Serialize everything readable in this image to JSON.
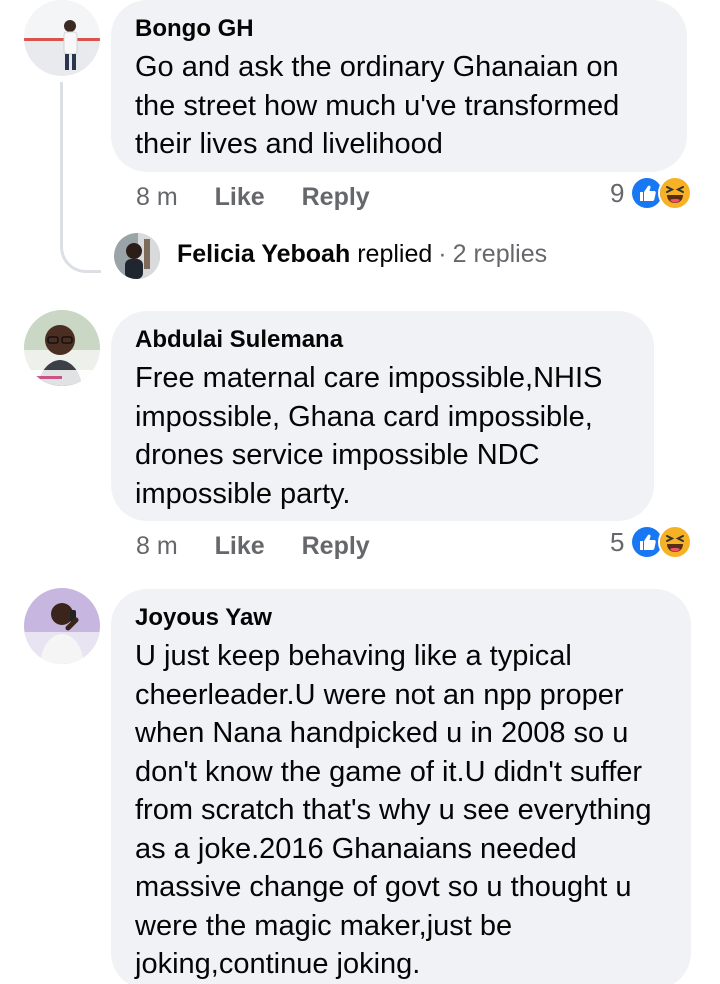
{
  "comments": [
    {
      "author": "Bongo GH",
      "text": "Go and ask the ordinary Ghanaian on the street how much u've transformed their lives and livelihood",
      "time": "8 m",
      "like_label": "Like",
      "reply_label": "Reply",
      "reaction_count": "9",
      "reactions": [
        "like-icon",
        "haha-icon"
      ]
    },
    {
      "author": "Abdulai Sulemana",
      "text": "Free maternal care impossible,NHIS impossible, Ghana card impossible, drones service impossible NDC impossible party.",
      "time": "8 m",
      "like_label": "Like",
      "reply_label": "Reply",
      "reaction_count": "5",
      "reactions": [
        "like-icon",
        "haha-icon"
      ]
    },
    {
      "author": "Joyous Yaw",
      "text": "U just keep behaving like a typical cheerleader.U were not an npp proper when Nana handpicked u in 2008 so u don't know the game of it.U didn't suffer from scratch that's why u see everything as a joke.2016 Ghanaians needed massive change of govt so u thought u were the magic maker,just be joking,continue joking."
    }
  ],
  "reply_summary": {
    "name": "Felicia Yeboah",
    "verb": "replied",
    "separator": "·",
    "count": "2 replies"
  },
  "colors": {
    "bubble": "#f0f2f5",
    "secondary_text": "#65676b",
    "like_blue": "#1877f2",
    "haha_yellow": "#f7b125"
  }
}
